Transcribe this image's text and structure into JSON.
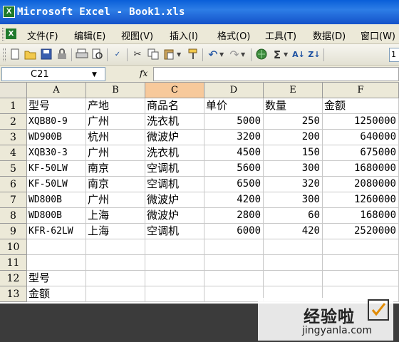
{
  "window": {
    "title": "Microsoft Excel - Book1.xls"
  },
  "menu": [
    "文件(F)",
    "编辑(E)",
    "视图(V)",
    "插入(I)",
    "格式(O)",
    "工具(T)",
    "数据(D)",
    "窗口(W)"
  ],
  "toolbar": {
    "icons": [
      "new-icon",
      "open-icon",
      "save-icon",
      "permission-icon",
      "print-icon",
      "print-preview-icon",
      "spelling-icon",
      "cut-icon",
      "copy-icon",
      "paste-icon",
      "format-painter-icon",
      "undo-icon",
      "redo-icon",
      "hyperlink-icon",
      "autosum-icon",
      "sort-ascending-icon",
      "sort-descending-icon"
    ],
    "fontsize": "1"
  },
  "formula_bar": {
    "name_box": "C21",
    "fx": "fx",
    "formula": ""
  },
  "columns": [
    "A",
    "B",
    "C",
    "D",
    "E",
    "F"
  ],
  "selected_column": "C",
  "rows": [
    {
      "n": "1",
      "cells": [
        "型号",
        "产地",
        "商品名",
        "单价",
        "数量",
        "金额"
      ]
    },
    {
      "n": "2",
      "cells": [
        "XQB80-9",
        "广州",
        "洗衣机",
        "5000",
        "250",
        "1250000"
      ]
    },
    {
      "n": "3",
      "cells": [
        "WD900B",
        "杭州",
        "微波炉",
        "3200",
        "200",
        "640000"
      ]
    },
    {
      "n": "4",
      "cells": [
        "XQB30-3",
        "广州",
        "洗衣机",
        "4500",
        "150",
        "675000"
      ]
    },
    {
      "n": "5",
      "cells": [
        "KF-50LW",
        "南京",
        "空调机",
        "5600",
        "300",
        "1680000"
      ]
    },
    {
      "n": "6",
      "cells": [
        "KF-50LW",
        "南京",
        "空调机",
        "6500",
        "320",
        "2080000"
      ]
    },
    {
      "n": "7",
      "cells": [
        "WD800B",
        "广州",
        "微波炉",
        "4200",
        "300",
        "1260000"
      ]
    },
    {
      "n": "8",
      "cells": [
        "WD800B",
        "上海",
        "微波炉",
        "2800",
        "60",
        "168000"
      ]
    },
    {
      "n": "9",
      "cells": [
        "KFR-62LW",
        "上海",
        "空调机",
        "6000",
        "420",
        "2520000"
      ]
    },
    {
      "n": "10",
      "cells": [
        "",
        "",
        "",
        "",
        "",
        ""
      ]
    },
    {
      "n": "11",
      "cells": [
        "",
        "",
        "",
        "",
        "",
        ""
      ]
    },
    {
      "n": "12",
      "cells": [
        "型号",
        "",
        "",
        "",
        "",
        ""
      ]
    },
    {
      "n": "13",
      "cells": [
        "金额",
        "",
        "",
        "",
        "",
        ""
      ]
    }
  ],
  "watermark": {
    "cn": "经验啦",
    "url": "jingyanla.com"
  }
}
